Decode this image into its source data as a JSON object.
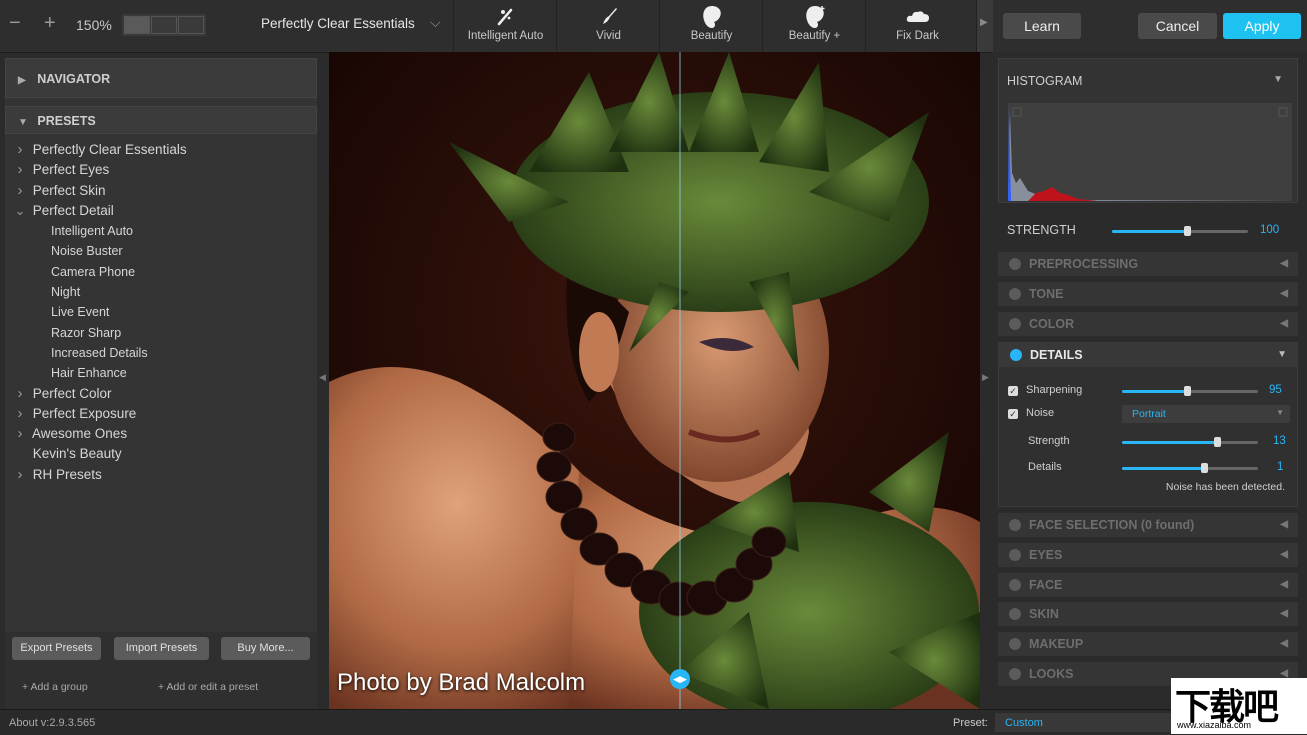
{
  "toolbar": {
    "zoom": "150%",
    "preset_name": "Perfectly Clear Essentials",
    "presets": [
      {
        "label": "Intelligent Auto",
        "icon": "wand-icon"
      },
      {
        "label": "Vivid",
        "icon": "brush-icon"
      },
      {
        "label": "Beautify",
        "icon": "face-icon"
      },
      {
        "label": "Beautify +",
        "icon": "face-plus-icon"
      },
      {
        "label": "Fix Dark",
        "icon": "cloud-icon"
      }
    ],
    "learn_label": "Learn",
    "cancel_label": "Cancel",
    "apply_label": "Apply"
  },
  "left_panel": {
    "navigator_label": "NAVIGATOR",
    "presets_label": "PRESETS",
    "tree": [
      {
        "label": "Perfectly Clear Essentials",
        "level": 0,
        "chev": "right"
      },
      {
        "label": "Perfect Eyes",
        "level": 0,
        "chev": "right"
      },
      {
        "label": "Perfect Skin",
        "level": 0,
        "chev": "right"
      },
      {
        "label": "Perfect Detail",
        "level": 0,
        "chev": "down"
      },
      {
        "label": "Intelligent Auto",
        "level": 1,
        "chev": ""
      },
      {
        "label": "Noise Buster",
        "level": 1,
        "chev": ""
      },
      {
        "label": "Camera Phone",
        "level": 1,
        "chev": ""
      },
      {
        "label": "Night",
        "level": 1,
        "chev": ""
      },
      {
        "label": "Live Event",
        "level": 1,
        "chev": ""
      },
      {
        "label": "Razor Sharp",
        "level": 1,
        "chev": ""
      },
      {
        "label": "Increased Details",
        "level": 1,
        "chev": ""
      },
      {
        "label": "Hair Enhance",
        "level": 1,
        "chev": ""
      },
      {
        "label": "Perfect Color",
        "level": 0,
        "chev": "right"
      },
      {
        "label": "Perfect Exposure",
        "level": 0,
        "chev": "right"
      },
      {
        "label": "Awesome Ones",
        "level": 0,
        "chev": "right"
      },
      {
        "label": "Kevin's Beauty",
        "level": 0,
        "chev": ""
      },
      {
        "label": "RH Presets",
        "level": 0,
        "chev": "right"
      }
    ],
    "export_label": "Export Presets",
    "import_label": "Import Presets",
    "buy_label": "Buy More...",
    "add_group_label": "+ Add a group",
    "add_preset_label": "+ Add or edit a preset"
  },
  "photo": {
    "caption": "Photo by Brad Malcolm",
    "watermark_site": "www.xiazaiba.com",
    "watermark_brand": "下载吧"
  },
  "right_panel": {
    "histogram_label": "HISTOGRAM",
    "strength_label": "STRENGTH",
    "strength_value": "100",
    "strength_level": 0.55,
    "sections_top": [
      "PREPROCESSING",
      "TONE",
      "COLOR"
    ],
    "details": {
      "label": "DETAILS",
      "sharpening_label": "Sharpening",
      "sharpening_value": "95",
      "sharpening_level": 0.48,
      "noise_label": "Noise",
      "noise_mode": "Portrait",
      "strength_label": "Strength",
      "strength_value": "13",
      "strength_level": 0.7,
      "details_label": "Details",
      "details_value": "1",
      "details_level": 0.6,
      "status": "Noise has been detected."
    },
    "sections_bottom": [
      "FACE SELECTION (0 found)",
      "EYES",
      "FACE",
      "SKIN",
      "MAKEUP",
      "LOOKS"
    ]
  },
  "status_bar": {
    "about": "About v:2.9.3.565",
    "preset_label": "Preset:",
    "preset_value": "Custom"
  },
  "colors": {
    "accent": "#29b6f6",
    "apply_bg": "#1ec2f0"
  }
}
